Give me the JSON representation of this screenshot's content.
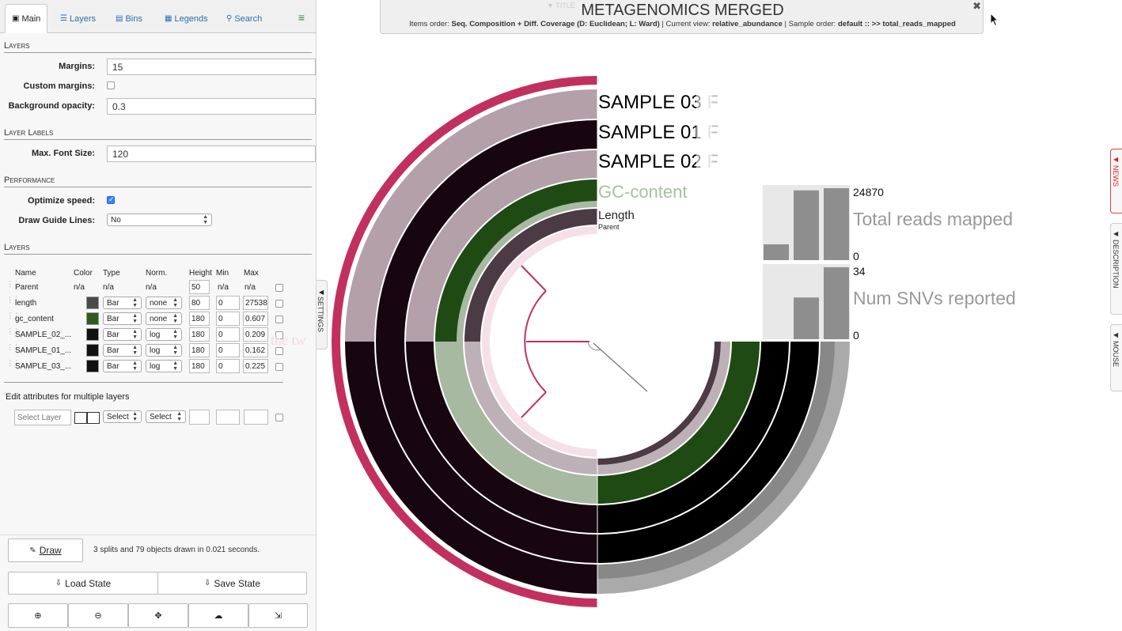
{
  "tabs": [
    {
      "label": "Main",
      "icon": "image-icon"
    },
    {
      "label": "Layers",
      "icon": "layers-icon"
    },
    {
      "label": "Bins",
      "icon": "bins-icon"
    },
    {
      "label": "Legends",
      "icon": "legends-icon"
    },
    {
      "label": "Search",
      "icon": "search-icon"
    }
  ],
  "main": {
    "layers_section": "Layers",
    "margins_label": "Margins:",
    "margins_value": "15",
    "custom_margins_label": "Custom margins:",
    "custom_margins_checked": false,
    "background_opacity_label": "Background opacity:",
    "background_opacity_value": "0.3",
    "layer_labels_section": "Layer Labels",
    "max_font_size_label": "Max. Font Size:",
    "max_font_size_value": "120",
    "performance_section": "Performance",
    "optimize_speed_label": "Optimize speed:",
    "optimize_speed_checked": true,
    "draw_guide_lines_label": "Draw Guide Lines:",
    "draw_guide_lines_value": "No",
    "layers_table_section": "Layers"
  },
  "layer_table": {
    "headers": {
      "name": "Name",
      "color": "Color",
      "type": "Type",
      "norm": "Norm.",
      "height": "Height",
      "min": "Min",
      "max": "Max"
    },
    "rows": [
      {
        "name": "Parent",
        "color": "",
        "color_text": "n/a",
        "type": "n/a",
        "norm": "n/a",
        "height": "50",
        "min": "n/a",
        "max": "n/a"
      },
      {
        "name": "length",
        "color": "#4a4a4a",
        "type": "Bar",
        "norm": "none",
        "height": "80",
        "min": "0",
        "max": "27538"
      },
      {
        "name": "gc_content",
        "color": "#2d5c1c",
        "type": "Bar",
        "norm": "none",
        "height": "180",
        "min": "0",
        "max": "0.607"
      },
      {
        "name": "SAMPLE_02_...",
        "color": "#111111",
        "type": "Bar",
        "norm": "log",
        "height": "180",
        "min": "0",
        "max": "0.209"
      },
      {
        "name": "SAMPLE_01_...",
        "color": "#111111",
        "type": "Bar",
        "norm": "log",
        "height": "180",
        "min": "0",
        "max": "0.162"
      },
      {
        "name": "SAMPLE_03_...",
        "color": "#111111",
        "type": "Bar",
        "norm": "log",
        "height": "180",
        "min": "0",
        "max": "0.225"
      }
    ],
    "ghost_text": "the tw"
  },
  "multi_edit": {
    "title": "Edit attributes for multiple layers",
    "select_layer_placeholder": "Select Layer",
    "type_select": "Select",
    "norm_select": "Select"
  },
  "draw": {
    "button_label": "Draw",
    "status": "3 splits and 79 objects drawn in 0.021 seconds."
  },
  "state": {
    "load_label": "Load State",
    "save_label": "Save State"
  },
  "toolbar_icons": [
    "zoom-in-icon",
    "zoom-out-icon",
    "center-icon",
    "upload-icon",
    "export-icon"
  ],
  "settings_handle_label": "SETTINGS",
  "title_box": {
    "small_label": "▼ TITLE",
    "title": "METAGENOMICS MERGED",
    "items_order_prefix": "Items order: ",
    "items_order": "Seq. Composition + Diff. Coverage (D: Euclidean; L: Ward)",
    "current_view_prefix": " | Current view: ",
    "current_view": "relative_abundance",
    "sample_order_prefix": " | Sample order: ",
    "sample_order": "default :: >> total_reads_mapped"
  },
  "side_tabs": [
    "NEWS",
    "DESCRIPTION",
    "MOUSE"
  ],
  "display": {
    "layer_labels": [
      {
        "text": "SAMPLE 03 F",
        "color": "#000000",
        "fade": "#bbbbbb"
      },
      {
        "text": "SAMPLE 01 F",
        "color": "#000000",
        "fade": "#bbbbbb"
      },
      {
        "text": "SAMPLE 02 F",
        "color": "#000000",
        "fade": "#bbbbbb"
      },
      {
        "text": "GC-content",
        "color": "#2d5c1c",
        "fade": "#a8c0a0"
      },
      {
        "text": "Length",
        "color": "#222222",
        "fade": "#222222"
      },
      {
        "text": "Parent",
        "color": "#222222",
        "fade": "#222222"
      }
    ],
    "colors": {
      "outer_ring": "#c2305f",
      "sample_light": "#b3a0a8",
      "sample_dark": "#17050f",
      "gc": "#1f4a14",
      "gc_light": "#a7b9a1",
      "length": "#4c3a44",
      "length_light": "#bdb0b6",
      "parent": "#f6e0e8",
      "tree": "#c2305f",
      "gray_ring": "#aaaaaa"
    }
  },
  "chart_data": [
    {
      "type": "bar",
      "title": "Total reads mapped",
      "max_label": "24870",
      "min_label": "0",
      "values": [
        0.22,
        0.97,
        1.0
      ]
    },
    {
      "type": "bar",
      "title": "Num SNVs reported",
      "max_label": "34",
      "min_label": "0",
      "values": [
        0.0,
        0.58,
        1.0
      ]
    }
  ]
}
